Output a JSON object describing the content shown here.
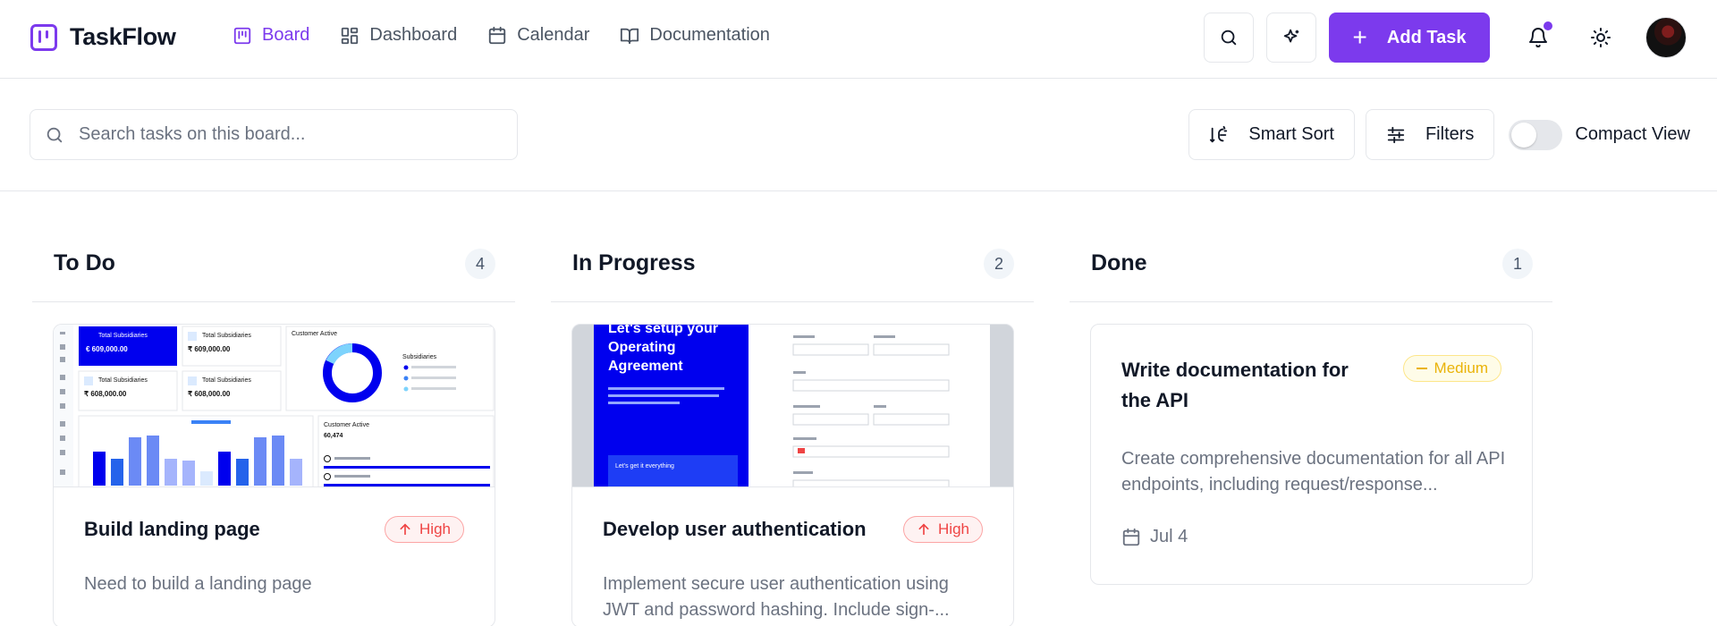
{
  "app": {
    "name": "TaskFlow"
  },
  "nav": {
    "items": [
      {
        "label": "Board",
        "icon": "board-icon",
        "active": true
      },
      {
        "label": "Dashboard",
        "icon": "dashboard-icon",
        "active": false
      },
      {
        "label": "Calendar",
        "icon": "calendar-icon",
        "active": false
      },
      {
        "label": "Documentation",
        "icon": "book-icon",
        "active": false
      }
    ]
  },
  "header": {
    "add_task_label": "Add Task",
    "has_notifications": true
  },
  "toolbar": {
    "search_placeholder": "Search tasks on this board...",
    "smart_sort_label": "Smart Sort",
    "filters_label": "Filters",
    "compact_view_label": "Compact View",
    "compact_view_on": false
  },
  "columns": [
    {
      "title": "To Do",
      "count": "4",
      "cards": [
        {
          "title": "Build landing page",
          "priority": "High",
          "description": "Need to build a landing page",
          "has_image": true
        }
      ]
    },
    {
      "title": "In Progress",
      "count": "2",
      "cards": [
        {
          "title": "Develop user authentication",
          "priority": "High",
          "description": "Implement secure user authentication using JWT and password hashing. Include sign-...",
          "has_image": true
        }
      ]
    },
    {
      "title": "Done",
      "count": "1",
      "cards": [
        {
          "title": "Write documentation for the API",
          "priority": "Medium",
          "description": "Create comprehensive documentation for all API endpoints, including request/response...",
          "date": "Jul 4",
          "has_image": false
        }
      ]
    }
  ],
  "thumbnails": {
    "landing": {
      "stat1_label": "Total Subsidiaries",
      "stat1_value": "€ 609,000.00",
      "stat2_label": "Total Subsidiaries",
      "stat2_value": "₹ 609,000.00",
      "stat3_label": "Total Subsidiaries",
      "stat3_value": "₹ 608,000.00",
      "stat4_label": "Total Subsidiaries",
      "stat4_value": "₹ 608,000.00",
      "donut_title": "Customer Active",
      "donut_legend_title": "Subsidiaries",
      "bars_title": "Customer Active",
      "bars_value": "60,474"
    },
    "auth": {
      "headline": "Let's setup your Operating Agreement",
      "cta": "Let's get it everything"
    }
  },
  "colors": {
    "accent": "#7c3aed",
    "high": "#ef4444",
    "medium": "#eab308"
  }
}
